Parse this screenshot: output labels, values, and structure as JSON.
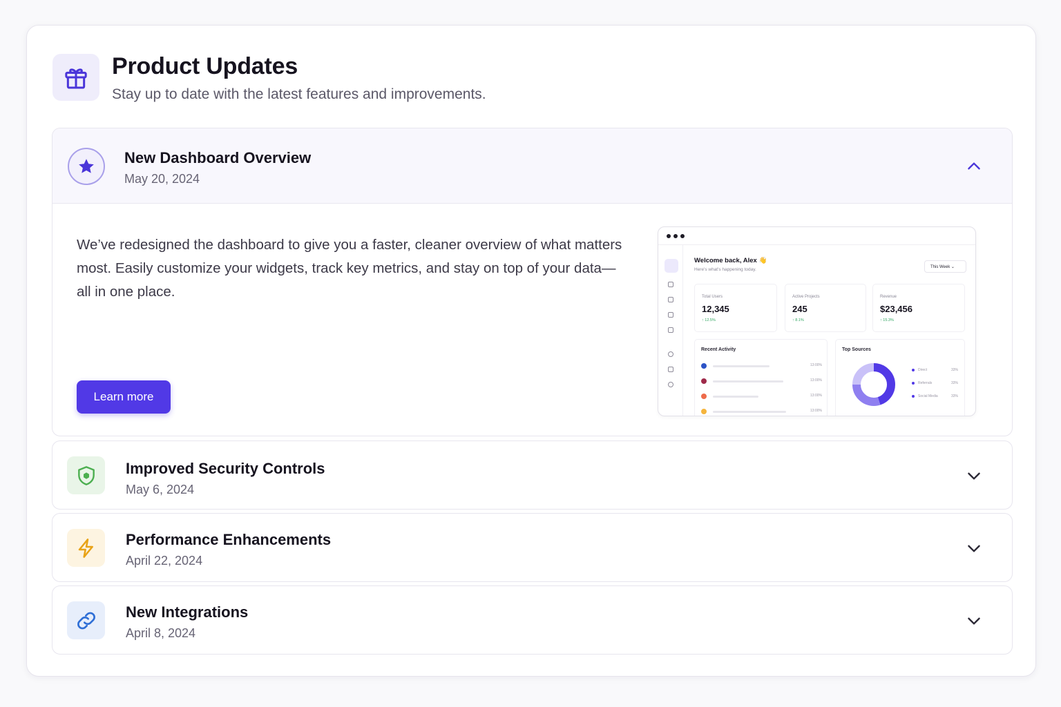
{
  "header": {
    "title": "Product Updates",
    "subtitle": "Stay up to date with the latest features and improvements.",
    "icon": "gift-icon"
  },
  "colors": {
    "accent": "#5139e6",
    "security": "#4caf50",
    "performance": "#e8a317",
    "integrations": "#2f6fd6"
  },
  "updates": [
    {
      "title": "New Dashboard Overview",
      "date": "May 20, 2024",
      "icon": "star-icon",
      "expanded": true,
      "description": "We’ve redesigned the dashboard to give you a faster, cleaner overview of what matters most. Easily customize your widgets, track key metrics, and stay on top of your data—all in one place.",
      "cta": "Learn more"
    },
    {
      "title": "Improved Security Controls",
      "date": "May 6, 2024",
      "icon": "shield-icon",
      "expanded": false
    },
    {
      "title": "Performance Enhancements",
      "date": "April 22, 2024",
      "icon": "lightning-icon",
      "expanded": false
    },
    {
      "title": "New Integrations",
      "date": "April 8, 2024",
      "icon": "link-icon",
      "expanded": false
    }
  ],
  "preview": {
    "welcome": "Welcome back, Alex 👋",
    "welcome_sub": "Here's what's happening today.",
    "range": "This Week",
    "stats": [
      {
        "label": "Total Users",
        "value": "12,345",
        "change": "↑ 12.5%"
      },
      {
        "label": "Active Projects",
        "value": "245",
        "change": "↑ 8.1%"
      },
      {
        "label": "Revenue",
        "value": "$23,456",
        "change": "↑ 15.3%"
      }
    ],
    "activity_title": "Recent Activity",
    "activity": [
      {
        "color": "#2c53c6",
        "time": "13:00%"
      },
      {
        "color": "#9e2a4a",
        "time": "13:00%"
      },
      {
        "color": "#ee6b4a",
        "time": "13:00%"
      },
      {
        "color": "#f5b43c",
        "time": "13:00%"
      }
    ],
    "sources_title": "Top Sources",
    "sources": [
      {
        "name": "Direct",
        "pct": "33%",
        "value": 45
      },
      {
        "name": "Referrals",
        "pct": "33%",
        "value": 30
      },
      {
        "name": "Social Media",
        "pct": "33%",
        "value": 25
      }
    ]
  }
}
